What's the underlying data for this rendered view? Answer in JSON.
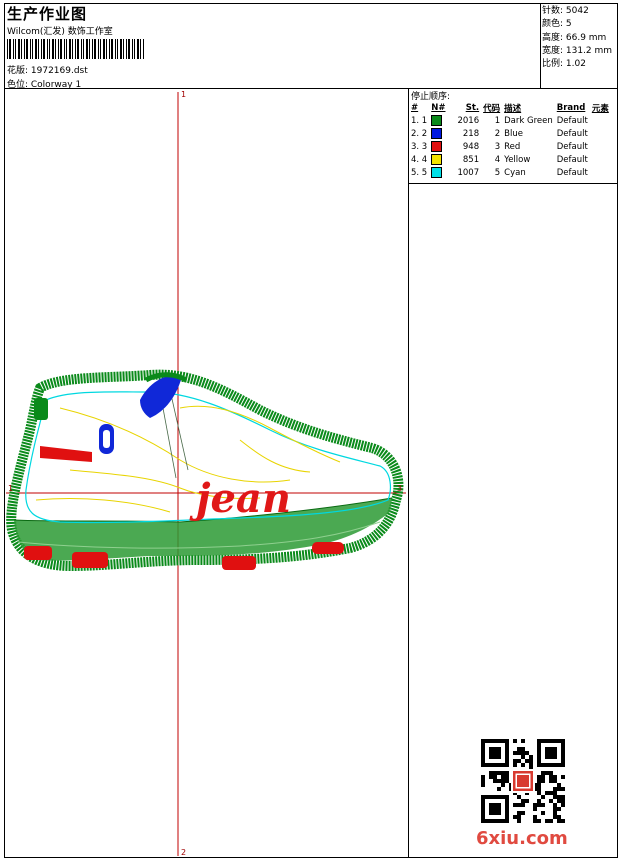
{
  "header": {
    "title": "生产作业图",
    "subtitle": "Wilcom(汇发) 数饰工作室",
    "design_label": "花版: 1972169.dst",
    "colorway_label": "色位: Colorway 1"
  },
  "stats": {
    "stitches": "针数: 5042",
    "colors": "颜色: 5",
    "height": "高度: 66.9 mm",
    "width": "宽度: 131.2 mm",
    "scale": "比例: 1.02"
  },
  "stop_sequence": {
    "title": "停止顺序:",
    "headers": [
      "#",
      "N#",
      "St.",
      "代码",
      "描述",
      "Brand",
      "元素"
    ],
    "rows": [
      {
        "idx": "1. 1",
        "color": "#0a8a1a",
        "st": "2016",
        "code": "1",
        "desc": "Dark Green",
        "brand": "Default"
      },
      {
        "idx": "2. 2",
        "color": "#0018e0",
        "st": "218",
        "code": "2",
        "desc": "Blue",
        "brand": "Default"
      },
      {
        "idx": "3. 3",
        "color": "#e01010",
        "st": "948",
        "code": "3",
        "desc": "Red",
        "brand": "Default"
      },
      {
        "idx": "4. 4",
        "color": "#f5e400",
        "st": "851",
        "code": "4",
        "desc": "Yellow",
        "brand": "Default"
      },
      {
        "idx": "5. 5",
        "color": "#00e0e8",
        "st": "1007",
        "code": "5",
        "desc": "Cyan",
        "brand": "Default"
      }
    ]
  },
  "canvas": {
    "axis_top": "1",
    "axis_left": "1",
    "axis_bottom": "2",
    "axis_right": "3",
    "design_text": "jean"
  },
  "watermark": "6xiu.com"
}
